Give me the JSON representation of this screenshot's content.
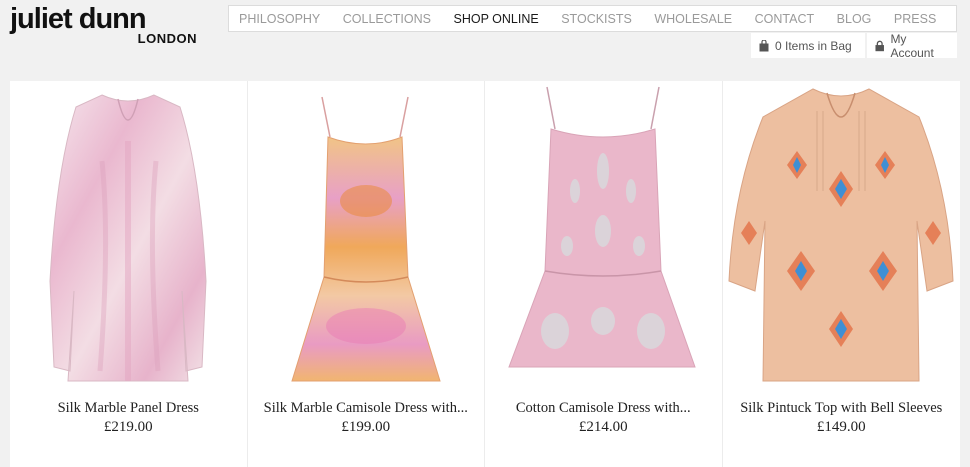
{
  "brand": {
    "name": "juliet dunn",
    "sub": "LONDON"
  },
  "nav": [
    {
      "label": "PHILOSOPHY",
      "active": false
    },
    {
      "label": "COLLECTIONS",
      "active": false
    },
    {
      "label": "SHOP ONLINE",
      "active": true
    },
    {
      "label": "STOCKISTS",
      "active": false
    },
    {
      "label": "WHOLESALE",
      "active": false
    },
    {
      "label": "CONTACT",
      "active": false
    },
    {
      "label": "BLOG",
      "active": false
    },
    {
      "label": "PRESS",
      "active": false
    }
  ],
  "utility": {
    "bag_label": "0 Items in Bag",
    "account_label": "My Account"
  },
  "products": [
    {
      "name": "Silk Marble Panel Dress",
      "price": "£219.00"
    },
    {
      "name": "Silk Marble Camisole Dress with...",
      "price": "£199.00"
    },
    {
      "name": "Cotton Camisole Dress with...",
      "price": "£214.00"
    },
    {
      "name": "Silk Pintuck Top with Bell Sleeves",
      "price": "£149.00"
    }
  ]
}
